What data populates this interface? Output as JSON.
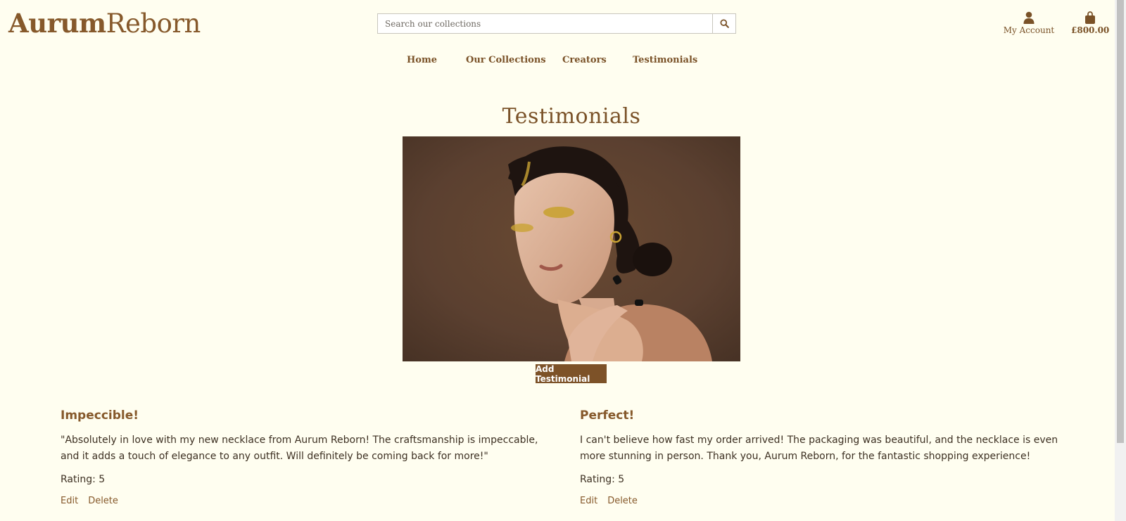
{
  "brand": {
    "logo_bold": "Aurum",
    "logo_regular": "Reborn"
  },
  "search": {
    "placeholder": "Search our collections"
  },
  "account": {
    "label": "My Account"
  },
  "cart": {
    "total": "£800.00"
  },
  "nav": {
    "items": [
      "Home",
      "Our Collections",
      "Creators",
      "Testimonials"
    ]
  },
  "page": {
    "title": "Testimonials",
    "add_button": "Add Testimonial"
  },
  "testimonials": [
    {
      "title": "Impeccible!",
      "quote": "\"Absolutely in love with my new necklace from Aurum Reborn! The craftsmanship is impeccable, and it adds a touch of elegance to any outfit. Will definitely be coming back for more!\"",
      "rating": "Rating: 5",
      "edit": "Edit",
      "delete": "Delete"
    },
    {
      "title": "Perfect!",
      "quote": "I can't believe how fast my order arrived! The packaging was beautiful, and the necklace is even more stunning in person. Thank you, Aurum Reborn, for the fantastic shopping experience!",
      "rating": "Rating: 5",
      "edit": "Edit",
      "delete": "Delete"
    }
  ],
  "colors": {
    "background": "#fffef0",
    "brand": "#86592b",
    "button": "#7d5228"
  }
}
